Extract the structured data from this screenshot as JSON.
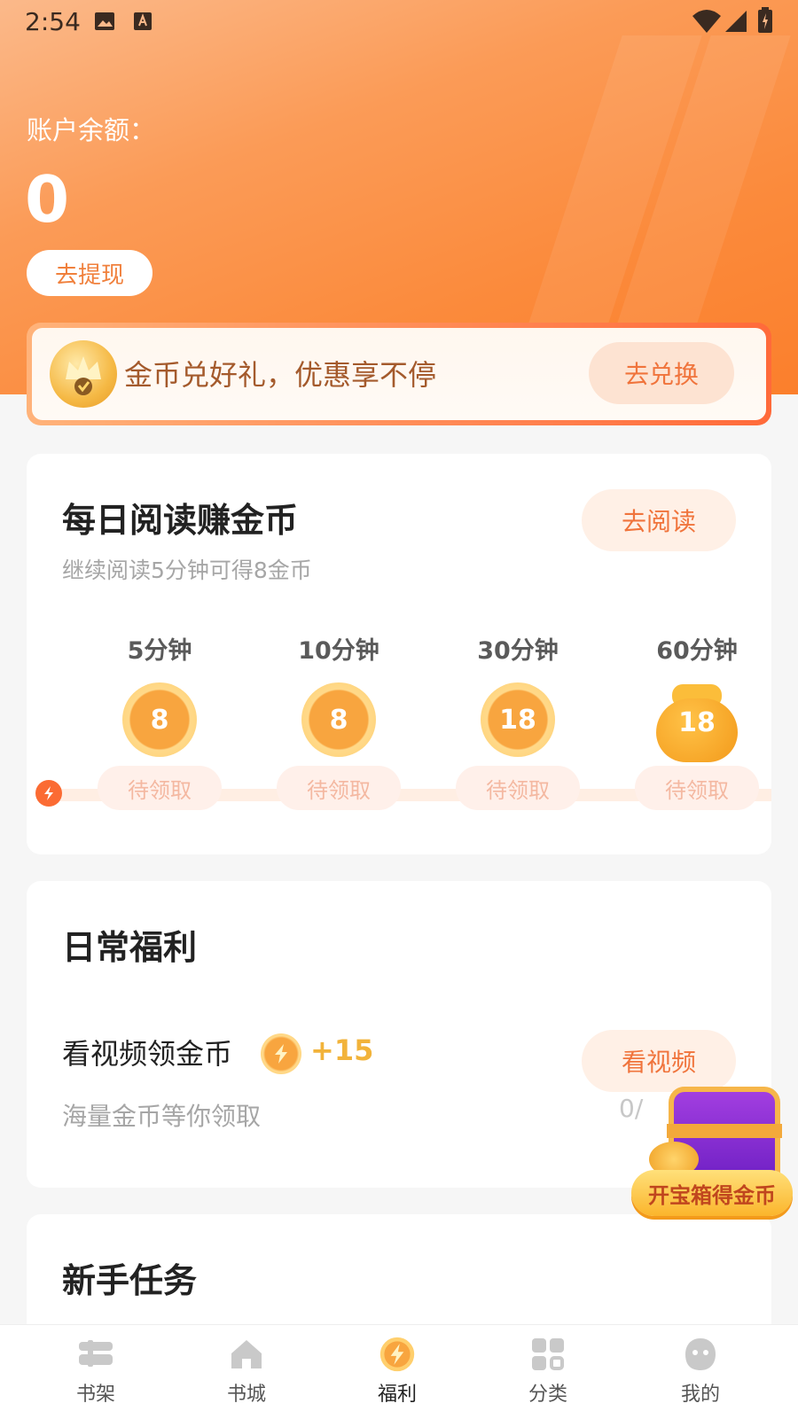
{
  "status_bar": {
    "time": "2:54"
  },
  "account": {
    "balance_label": "账户余额：",
    "balance_value": "0",
    "withdraw_label": "去提现"
  },
  "promo_banner": {
    "text": "金币兑好礼，优惠享不停",
    "button_label": "去兑换"
  },
  "daily_reading": {
    "title": "每日阅读赚金币",
    "button_label": "去阅读",
    "subtitle": "继续阅读5分钟可得8金币",
    "milestones": [
      {
        "label": "5分钟",
        "coins": "8",
        "status": "待领取"
      },
      {
        "label": "10分钟",
        "coins": "8",
        "status": "待领取"
      },
      {
        "label": "30分钟",
        "coins": "18",
        "status": "待领取"
      },
      {
        "label": "60分钟",
        "coins": "18",
        "status": "待领取"
      }
    ]
  },
  "daily_benefits": {
    "title": "日常福利",
    "task": {
      "title": "看视频领金币",
      "reward": "+15",
      "subtitle": "海量金币等你领取",
      "button_label": "看视频",
      "progress": "0/"
    }
  },
  "treasure_chest": {
    "label": "开宝箱得金币"
  },
  "newbie_tasks": {
    "title": "新手任务"
  },
  "tabbar": {
    "items": [
      {
        "label": "书架",
        "icon": "bookshelf-icon"
      },
      {
        "label": "书城",
        "icon": "home-icon"
      },
      {
        "label": "福利",
        "icon": "bolt-coin-icon",
        "active": true
      },
      {
        "label": "分类",
        "icon": "grid-icon"
      },
      {
        "label": "我的",
        "icon": "profile-icon"
      }
    ]
  },
  "colors": {
    "accent": "#fb8a3b",
    "button_text": "#f0743c",
    "coin": "#f8a53f"
  }
}
